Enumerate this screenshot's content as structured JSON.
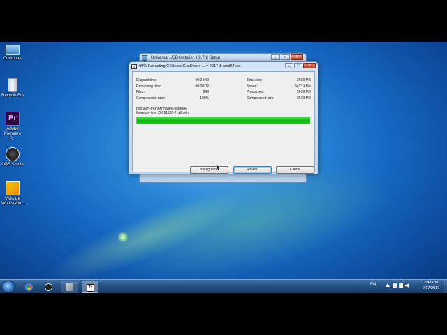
{
  "desktop": {
    "icons": [
      {
        "label": "Computer",
        "icon": "computer-icon"
      },
      {
        "label": "Recycle Bin",
        "icon": "recycle-bin-icon"
      },
      {
        "label": "Adobe Premiere P...",
        "icon": "premiere-icon"
      },
      {
        "label": "OBS Studio",
        "icon": "obs-icon"
      },
      {
        "label": "VMware Workstatio...",
        "icon": "vmware-icon"
      }
    ]
  },
  "background_window": {
    "title": "Universal USB Installer 1.9.7.8 Setup"
  },
  "dialog": {
    "title_icon": "7z",
    "title": "99% Extracting C:\\Users\\Gio\\Downl ... v-2017.1-amd64.iso",
    "controls": {
      "minimize": "_",
      "maximize": "□",
      "close": "X"
    },
    "left_stats": [
      {
        "label": "Elapsed time:",
        "value": "00:04:49"
      },
      {
        "label": "Remaining time:",
        "value": "00:00:02"
      },
      {
        "label": "Files:",
        "value": "943"
      },
      {
        "label": "Compression ratio:",
        "value": "100%"
      }
    ],
    "right_stats": [
      {
        "label": "Total size:",
        "value": "2698 MB"
      },
      {
        "label": "Speed:",
        "value": "9493 KB/s"
      },
      {
        "label": "Processed:",
        "value": "2679 MB"
      },
      {
        "label": "Compressed size:",
        "value": "2679 MB"
      }
    ],
    "current_file_line1": "pool\\non-free\\f\\firmware-nonfree\\",
    "current_file_line2": "firmware-ivtv_20161130-2_all.deb",
    "progress_fraction": 0.99,
    "buttons": {
      "background": "Background",
      "pause": "Pause",
      "cancel": "Cancel"
    }
  },
  "taskbar": {
    "apps": [
      "start-orb",
      "chrome-icon",
      "obs-icon",
      "usb-installer-icon",
      "7zip-icon"
    ],
    "language": "EN",
    "time": "2:48 PM",
    "date": "9/17/2017"
  },
  "colors": {
    "progress_green": "#1cc21c",
    "desktop_blue": "#1565c0",
    "taskbar": "#244e80"
  }
}
